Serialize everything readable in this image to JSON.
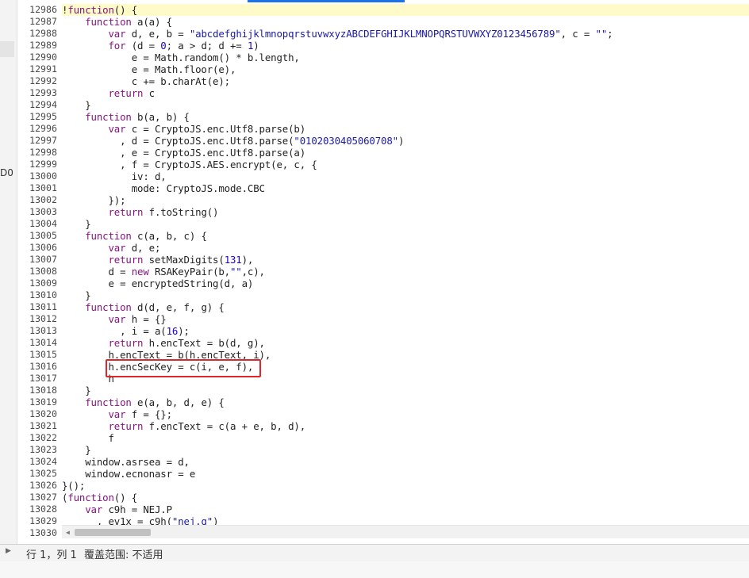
{
  "editor": {
    "line_numbers": [
      "12986",
      "12987",
      "12988",
      "12989",
      "12990",
      "12991",
      "12992",
      "12993",
      "12994",
      "12995",
      "12996",
      "12997",
      "12998",
      "12999",
      "13000",
      "13001",
      "13002",
      "13003",
      "13004",
      "13005",
      "13006",
      "13007",
      "13008",
      "13009",
      "13010",
      "13011",
      "13012",
      "13013",
      "13014",
      "13015",
      "13016",
      "13017",
      "13018",
      "13019",
      "13020",
      "13021",
      "13022",
      "13023",
      "13024",
      "13025",
      "13026",
      "13027",
      "13028",
      "13029",
      "13030"
    ],
    "lines": [
      "!function() {",
      "    function a(a) {",
      "        var d, e, b = \"abcdefghijklmnopqrstuvwxyzABCDEFGHIJKLMNOPQRSTUVWXYZ0123456789\", c = \"\";",
      "        for (d = 0; a > d; d += 1)",
      "            e = Math.random() * b.length,",
      "            e = Math.floor(e),",
      "            c += b.charAt(e);",
      "        return c",
      "    }",
      "    function b(a, b) {",
      "        var c = CryptoJS.enc.Utf8.parse(b)",
      "          , d = CryptoJS.enc.Utf8.parse(\"0102030405060708\")",
      "          , e = CryptoJS.enc.Utf8.parse(a)",
      "          , f = CryptoJS.AES.encrypt(e, c, {",
      "            iv: d,",
      "            mode: CryptoJS.mode.CBC",
      "        });",
      "        return f.toString()",
      "    }",
      "    function c(a, b, c) {",
      "        var d, e;",
      "        return setMaxDigits(131),",
      "        d = new RSAKeyPair(b,\"\",c),",
      "        e = encryptedString(d, a)",
      "    }",
      "    function d(d, e, f, g) {",
      "        var h = {}",
      "          , i = a(16);",
      "        return h.encText = b(d, g),",
      "        h.encText = b(h.encText, i),",
      "        h.encSecKey = c(i, e, f),",
      "        h",
      "    }",
      "    function e(a, b, d, e) {",
      "        var f = {};",
      "        return f.encText = c(a + e, b, d),",
      "        f",
      "    }",
      "    window.asrsea = d,",
      "    window.ecnonasr = e",
      "}();",
      "(function() {",
      "    var c9h = NEJ.P",
      "      , ev1x = c9h(\"nej.g\")",
      ""
    ],
    "active_line_index": 0,
    "highlighted_line_index": 30
  },
  "left_panel": {
    "tag": "D0"
  },
  "statusbar": {
    "position": "行 1，列 1",
    "coverage": "覆盖范围: 不适用"
  },
  "icons": {
    "drawer_toggle": "caret-right-icon",
    "scroll_left": "arrow-left-icon"
  },
  "colors": {
    "keyword": "#881280",
    "string": "#1a1aa6",
    "number": "#1c00cf",
    "active_line_bg": "#fffbc8",
    "highlight_box": "#e0262a",
    "tab_accent": "#1a73e8"
  }
}
